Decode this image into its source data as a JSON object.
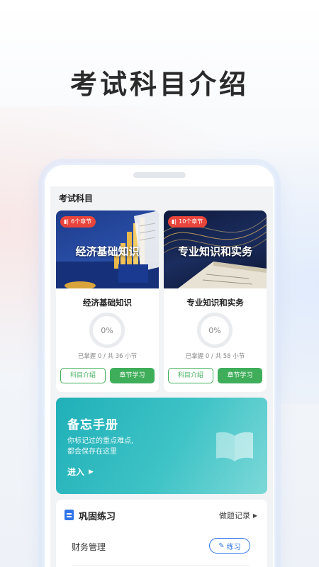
{
  "headline": "考试科目介绍",
  "section_title": "考试科目",
  "subjects": [
    {
      "badge": "6个章节",
      "cover_title": "经济基础知识",
      "name": "经济基础知识",
      "progress_value": "0%",
      "progress_text": "已掌握 0 / 共 36 小节",
      "intro_label": "科目介绍",
      "study_label": "章节学习"
    },
    {
      "badge": "10个章节",
      "cover_title": "专业知识和实务",
      "name": "专业知识和实务",
      "progress_value": "0%",
      "progress_text": "已掌握 0 / 共 58 小节",
      "intro_label": "科目介绍",
      "study_label": "章节学习"
    }
  ],
  "memo": {
    "title": "备忘手册",
    "desc_line1": "你标记过的重点难点,",
    "desc_line2": "都会保存在这里",
    "enter_label": "进入"
  },
  "practice": {
    "title": "巩固练习",
    "record_label": "做题记录",
    "rows": [
      {
        "label": "财务管理",
        "button_label": "练习"
      }
    ]
  },
  "colors": {
    "accent_green": "#3fae5a",
    "accent_blue": "#2f74e8",
    "badge_red": "#e8453c",
    "memo_teal": "#20b0b8"
  },
  "icons": [
    "audio-icon",
    "book-icon",
    "clipboard-icon",
    "chevron-right-icon",
    "pencil-icon"
  ]
}
